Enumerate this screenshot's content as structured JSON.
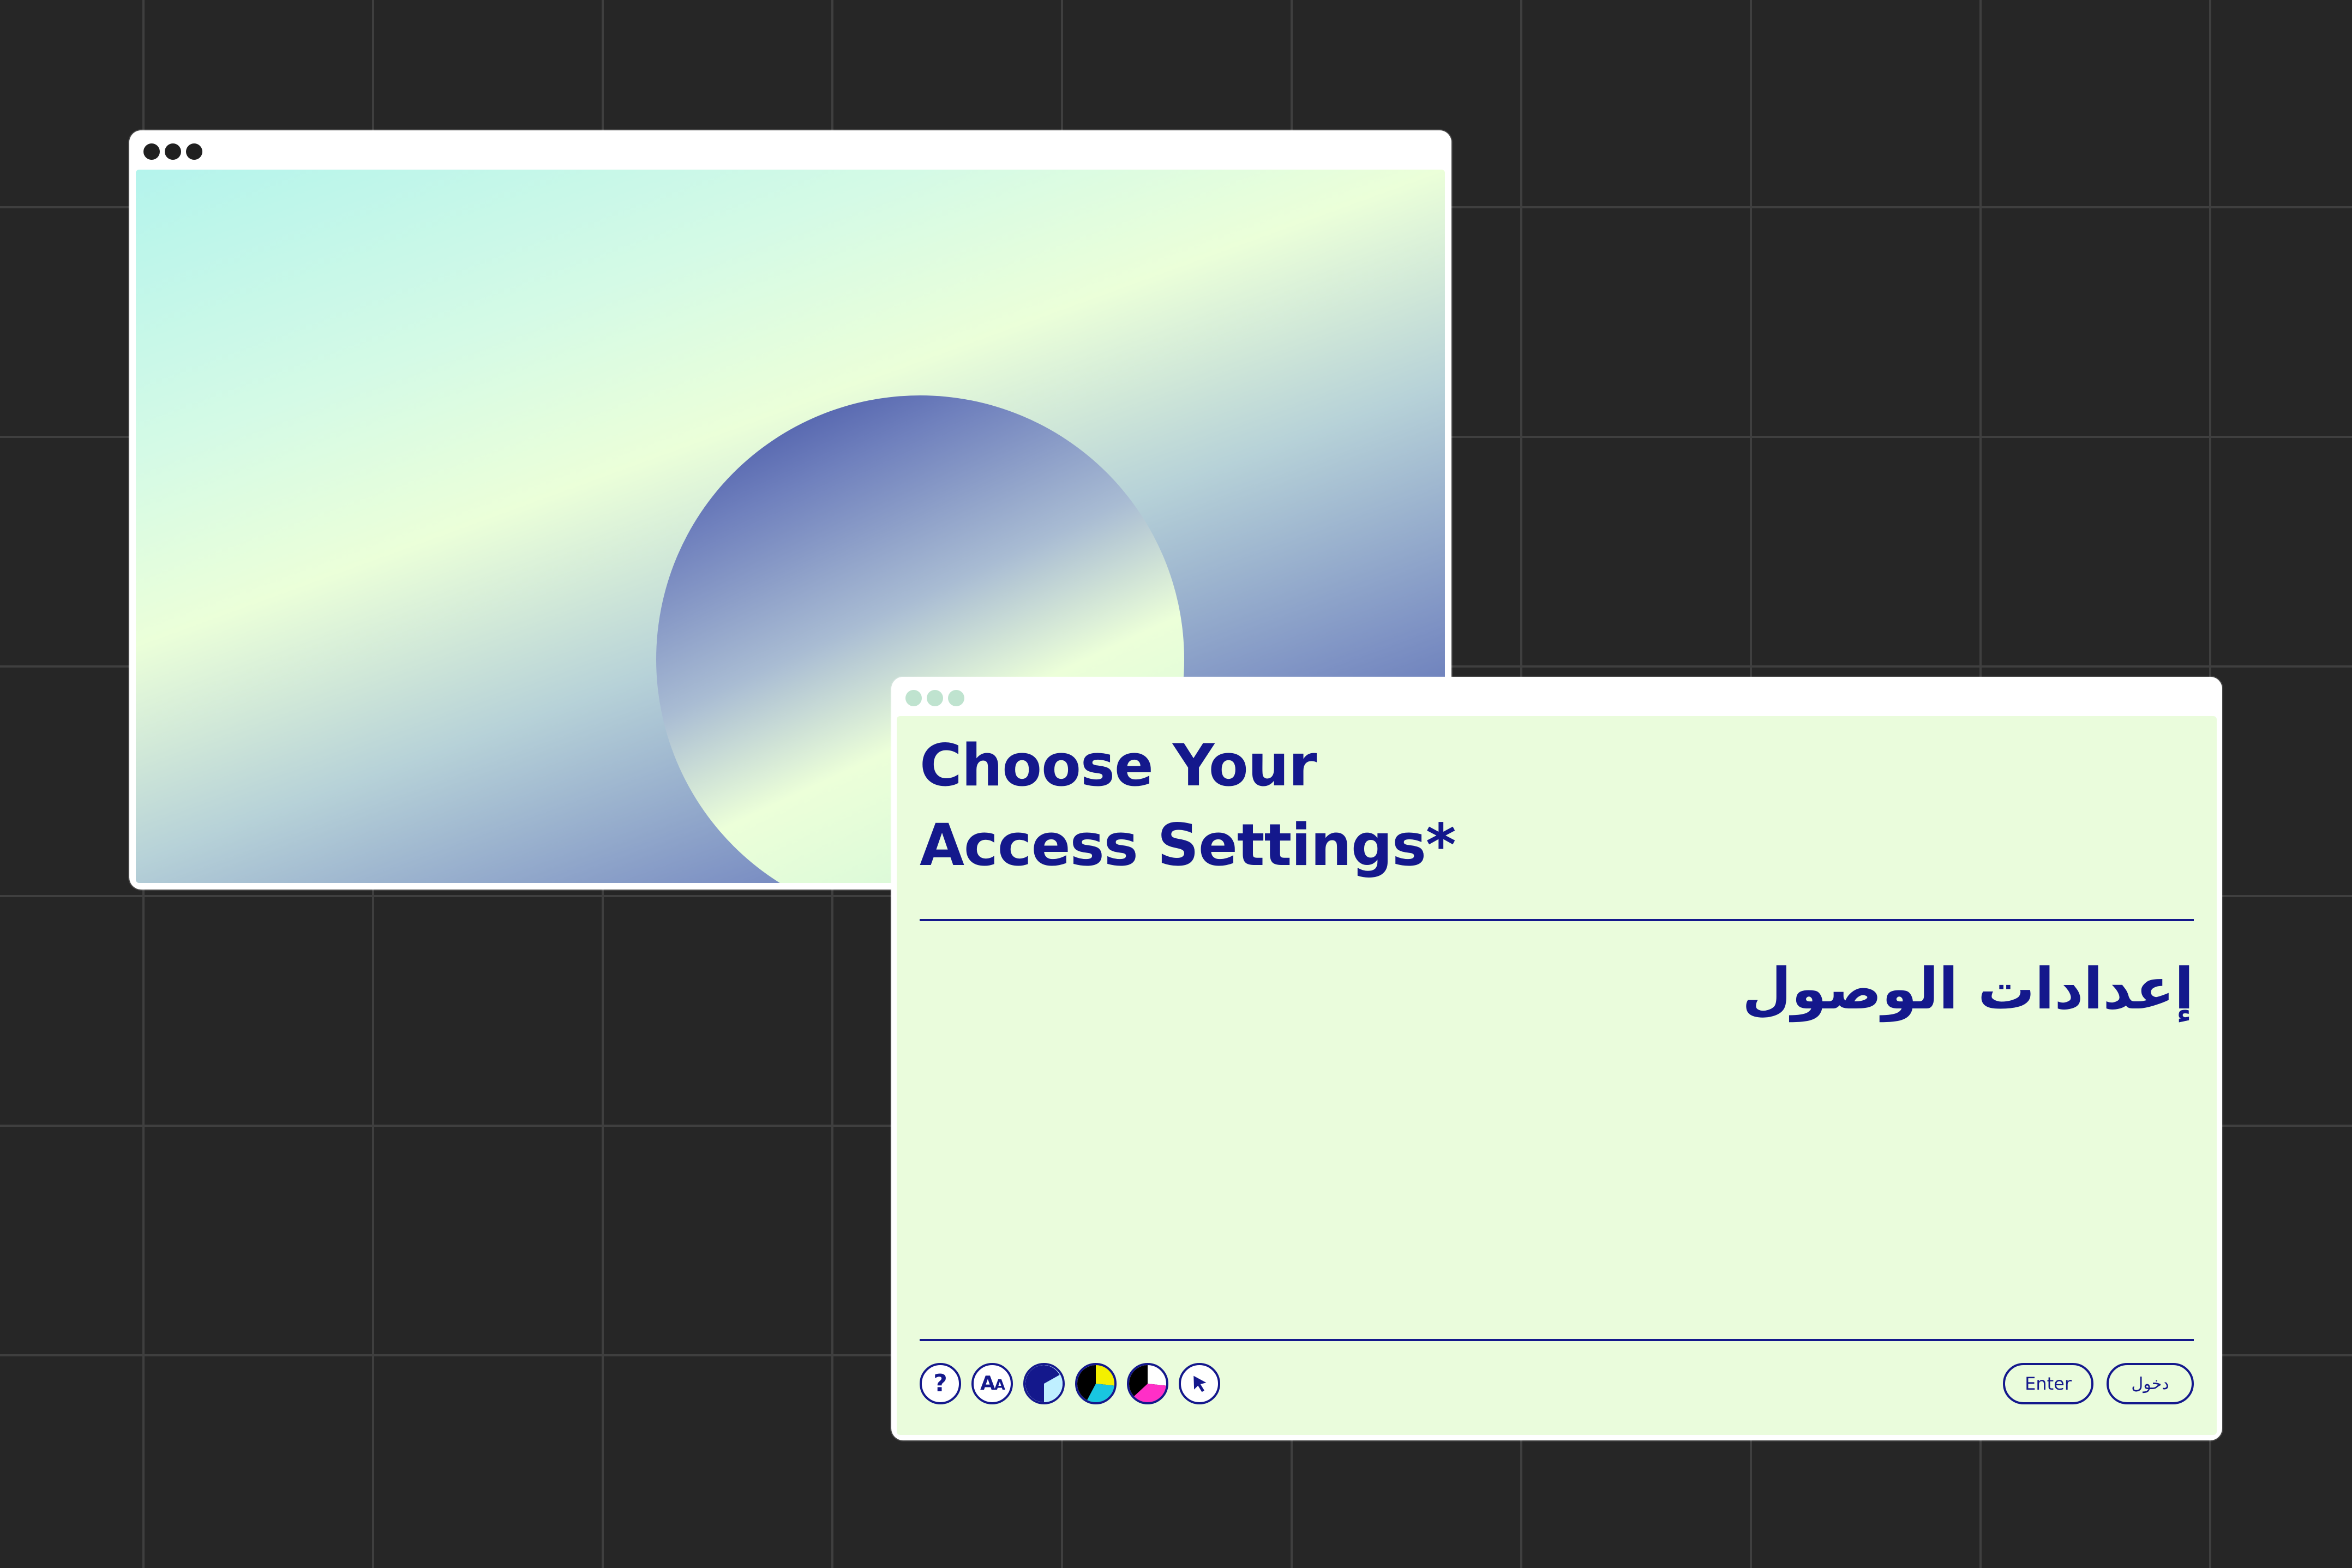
{
  "colors": {
    "background": "#262626",
    "grid_line": "#3f3f3f",
    "window_frame": "#ffffff",
    "back_window_dots": "#202020",
    "front_window_dots": "#bfe3cf",
    "panel_background": "#eafcdc",
    "accent_navy": "#14188c",
    "gradient_mint": "#b4f4ec",
    "gradient_cream": "#ebffd9",
    "gradient_indigo": "#3d4fa6"
  },
  "back_window": {
    "controls": [
      "dot",
      "dot",
      "dot"
    ],
    "content": "gradient-orb-illustration"
  },
  "front_window": {
    "controls": [
      "dot",
      "dot",
      "dot"
    ],
    "title_line_1": "Choose Your",
    "title_line_2": "Access Settings*",
    "title_arabic": "إعدادات الوصول",
    "toolbar": [
      {
        "name": "help-icon",
        "glyph": "?"
      },
      {
        "name": "text-size-icon",
        "glyph": "Aa"
      },
      {
        "name": "contrast-blue-icon",
        "colors": [
          "#14188c",
          "#bfefff"
        ]
      },
      {
        "name": "contrast-yellow-icon",
        "colors": [
          "#000000",
          "#f4f000",
          "#19c6e0"
        ]
      },
      {
        "name": "contrast-magenta-icon",
        "colors": [
          "#000000",
          "#ffffff",
          "#ff2fc7"
        ]
      },
      {
        "name": "cursor-icon",
        "glyph": "pointer"
      }
    ],
    "enter_label": "Enter",
    "enter_label_arabic": "دخول"
  }
}
